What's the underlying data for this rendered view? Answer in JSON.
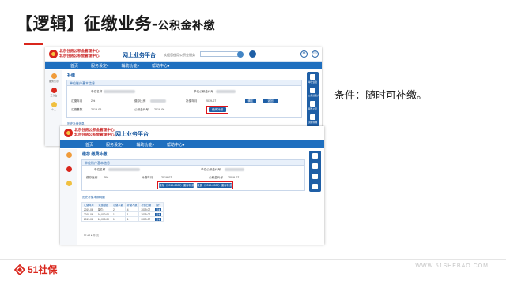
{
  "slide": {
    "title_main": "【逻辑】征缴业务-",
    "title_sub": "公积金补缴",
    "condition": "条件：随时可补缴。",
    "logo_text": "51社保",
    "site_url": "WWW.51SHEBAO.COM",
    "accent_color": "#d9261c"
  },
  "window1": {
    "org_line1": "北京住房公积金管理中心",
    "org_line2": "北京住房公积金管理中心",
    "platform": "网上业务平台",
    "greeting": "欢迎您使用公积金服务",
    "nav": [
      "首页",
      "服务设定▾",
      "辅助功能▾",
      "帮助中心▾"
    ],
    "crumb": "补缴",
    "panel_title": "单位账户基本信息",
    "fields": [
      "单位名称",
      "单位公积金代号",
      "汇缴年月",
      "缴存比例",
      "补缴年月",
      "汇缴基数",
      "公积金代号"
    ],
    "values": [
      "2%",
      "2019-07",
      "2019-06",
      "2019-06"
    ],
    "highlight_button": "缴纳补缴",
    "buttons": [
      "确定",
      "返回"
    ],
    "left_rail": [
      "服务公示",
      "工作台",
      "个人"
    ],
    "right_rail": [
      "单位信息",
      "公积金账户",
      "服务公示",
      "流程查询"
    ],
    "lower_label": "历史补缴信息"
  },
  "window2": {
    "org_line1": "北京住房公积金管理中心",
    "org_line2": "北京住房公积金管理中心",
    "platform": "网上业务平台",
    "nav": [
      "首页",
      "服务设定▾",
      "辅助功能▾",
      "帮助中心▾"
    ],
    "crumb": "缴存 缴费补缴",
    "panel_title": "单位账户基本信息",
    "fields": [
      "单位名称",
      "缴存比例",
      "补缴年月",
      "单位公积金代号",
      "公积金代号"
    ],
    "values": [
      "5%",
      "2019-07",
      "2019-07",
      "2019-07"
    ],
    "highlight_buttons": [
      "缴存（2019-2020）缴存补缴",
      "缴费（2019-2020）缴存补缴"
    ],
    "table_title": "历史补缴本期明细",
    "table_headers": [
      "汇缴年月",
      "汇缴基数",
      "汇缴人数",
      "补缴人数",
      "补缴日期",
      "操作"
    ],
    "table_rows": [
      [
        "2019-06",
        "单位:",
        "2",
        "4",
        "2019-07",
        "查看"
      ],
      [
        "2019-06",
        "10,000.00",
        "1",
        "1",
        "2019-07",
        "查看"
      ],
      [
        "2019-06",
        "10,000.00",
        "1",
        "1",
        "2019-07",
        "查看"
      ]
    ],
    "pager": "10  ◂  1  ▸  共1页"
  }
}
